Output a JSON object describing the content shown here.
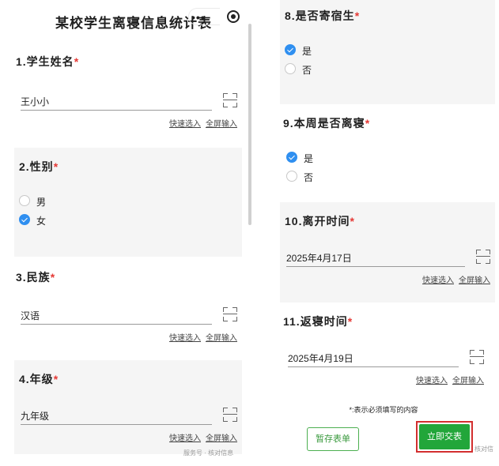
{
  "left": {
    "title": "某校学生离寝信息统计表",
    "menu_dots": "•••",
    "q1": {
      "title": "1.学生姓名",
      "value": "王小小"
    },
    "q2": {
      "title": "2.性别",
      "options": [
        "男",
        "女"
      ],
      "selected": 1
    },
    "q3": {
      "title": "3.民族",
      "value": "汉语"
    },
    "q4": {
      "title": "4.年级",
      "value": "九年级"
    },
    "quick_select": "快速选入",
    "full_screen": "全屏输入",
    "watermark": "服务号 · 核对信息"
  },
  "right": {
    "q8": {
      "title": "8.是否寄宿生",
      "options": [
        "是",
        "否"
      ],
      "selected": 0
    },
    "q9": {
      "title": "9.本周是否离寝",
      "options": [
        "是",
        "否"
      ],
      "selected": 0
    },
    "q10": {
      "title": "10.离开时间",
      "value": "2025年4月17日"
    },
    "q11": {
      "title": "11.返寝时间",
      "value": "2025年4月19日"
    },
    "quick_select": "快速选入",
    "full_screen": "全屏输入",
    "required_note": "*:表示必须填写的内容",
    "save_label": "暂存表单",
    "submit_label": "立即交表",
    "watermark": "核对信"
  },
  "required_mark": "*",
  "colors": {
    "accent_green": "#22a63a",
    "radio_blue": "#2f8ff0",
    "required_red": "#e53935",
    "highlight_red": "#d32f2f"
  }
}
